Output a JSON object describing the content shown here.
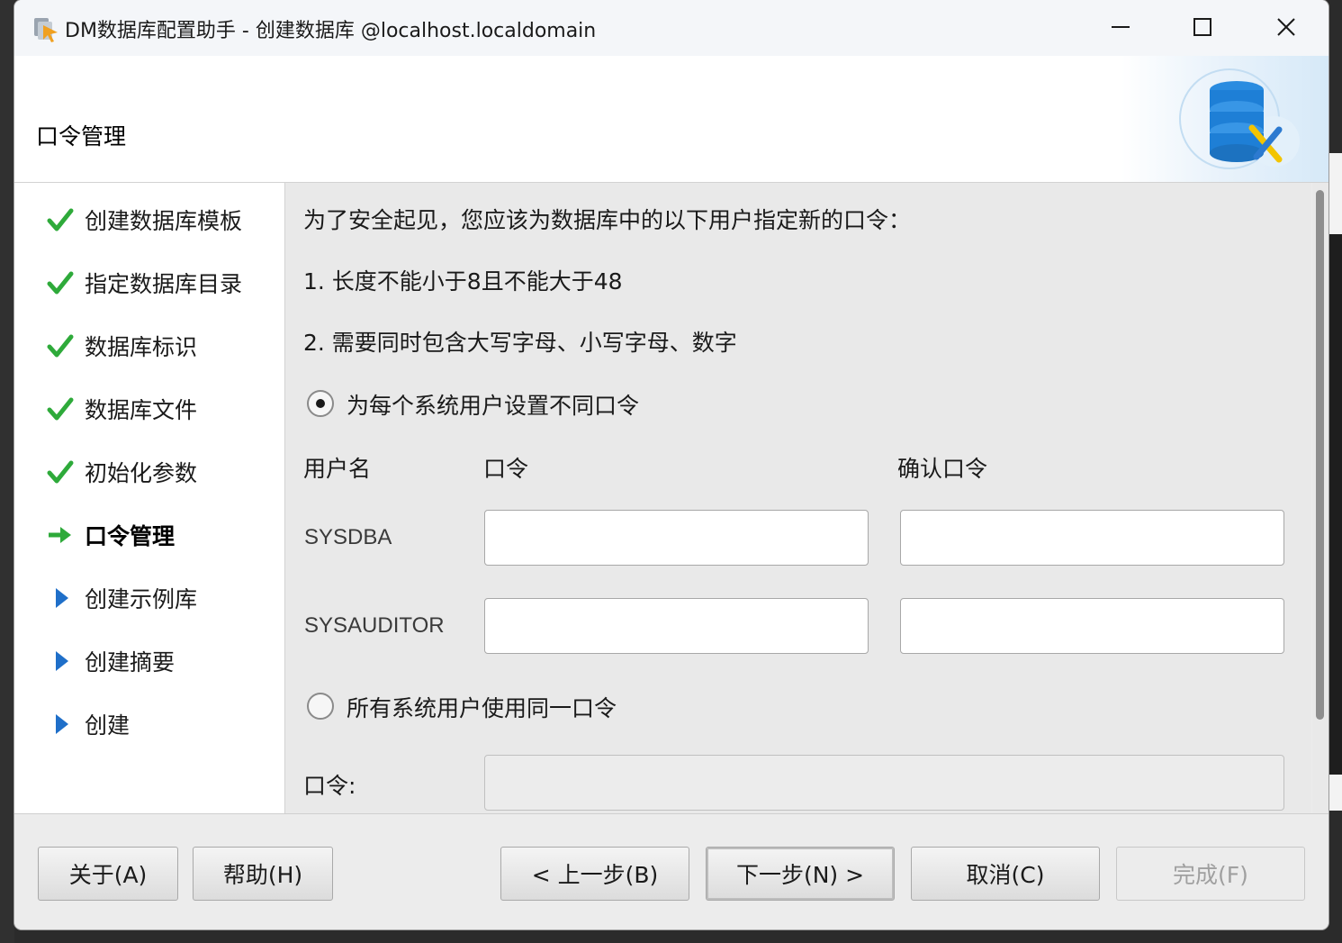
{
  "window": {
    "title": "DM数据库配置助手 - 创建数据库 @localhost.localdomain"
  },
  "header": {
    "title": "口令管理"
  },
  "steps": [
    {
      "label": "创建数据库模板",
      "state": "done"
    },
    {
      "label": "指定数据库目录",
      "state": "done"
    },
    {
      "label": "数据库标识",
      "state": "done"
    },
    {
      "label": "数据库文件",
      "state": "done"
    },
    {
      "label": "初始化参数",
      "state": "done"
    },
    {
      "label": "口令管理",
      "state": "current"
    },
    {
      "label": "创建示例库",
      "state": "pending"
    },
    {
      "label": "创建摘要",
      "state": "pending"
    },
    {
      "label": "创建",
      "state": "pending"
    }
  ],
  "content": {
    "intro": "为了安全起见，您应该为数据库中的以下用户指定新的口令：",
    "rule1": "1. 长度不能小于8且不能大于48",
    "rule2": "2. 需要同时包含大写字母、小写字母、数字",
    "option_separate": "为每个系统用户设置不同口令",
    "option_separate_selected": true,
    "col_user": "用户名",
    "col_password": "口令",
    "col_confirm": "确认口令",
    "users": [
      {
        "name": "SYSDBA",
        "password": "",
        "confirm": ""
      },
      {
        "name": "SYSAUDITOR",
        "password": "",
        "confirm": ""
      }
    ],
    "option_same": "所有系统用户使用同一口令",
    "option_same_selected": false,
    "same_password_label": "口令:",
    "same_password_value": ""
  },
  "footer": {
    "about": "关于(A)",
    "help": "帮助(H)",
    "prev": "< 上一步(B)",
    "next": "下一步(N) >",
    "cancel": "取消(C)",
    "finish": "完成(F)"
  },
  "colors": {
    "check": "#2eaa3a",
    "arrow_current": "#2eaa3a",
    "arrow_pending": "#1f6fc9",
    "db_icon": "#1e7fd6"
  },
  "icons": {
    "done": "check-icon",
    "current": "arrow-right-icon",
    "pending": "triangle-right-icon"
  }
}
